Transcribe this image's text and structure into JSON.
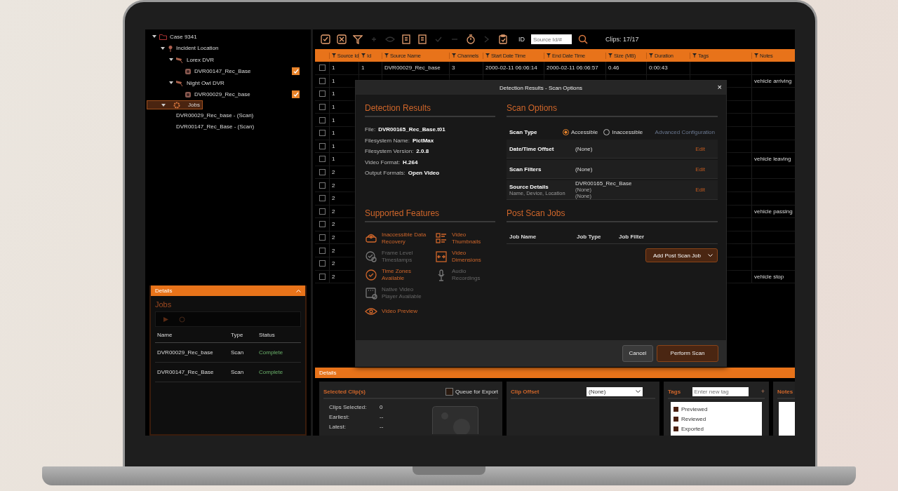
{
  "tree": [
    {
      "label": "Case 9341",
      "kind": "case",
      "expanded": true,
      "selected": false,
      "children": [
        {
          "label": "Incident Location",
          "kind": "location",
          "expanded": true,
          "selected": false,
          "children": [
            {
              "label": "Lorex DVR",
              "kind": "dvr",
              "expanded": true,
              "selected": false,
              "children": [
                {
                  "label": "DVR00147_Rec_Base",
                  "kind": "file",
                  "checked": true,
                  "selected": false
                }
              ]
            },
            {
              "label": "Night Owl DVR",
              "kind": "dvr",
              "expanded": true,
              "selected": false,
              "children": [
                {
                  "label": "DVR00029_Rec_base",
                  "kind": "file",
                  "checked": true,
                  "selected": false
                }
              ]
            }
          ]
        },
        {
          "label": "Jobs",
          "kind": "jobs",
          "expanded": true,
          "selected": true,
          "children": [
            {
              "label": "DVR00029_Rec_base - (Scan)",
              "kind": "job",
              "selected": false
            },
            {
              "label": "DVR00147_Rec_Base - (Scan)",
              "kind": "job",
              "selected": false
            }
          ]
        }
      ]
    }
  ],
  "jobs_panel": {
    "header": "Details",
    "title": "Jobs",
    "columns": [
      "Name",
      "Type",
      "Status"
    ],
    "rows": [
      {
        "name": "DVR00029_Rec_base",
        "type": "Scan",
        "status": "Complete"
      },
      {
        "name": "DVR00147_Rec_Base",
        "type": "Scan",
        "status": "Complete"
      }
    ]
  },
  "toolbar": {
    "tools": [
      {
        "kind": "check",
        "disabled": false
      },
      {
        "kind": "cross",
        "disabled": false
      },
      {
        "kind": "filter",
        "disabled": false
      },
      {
        "kind": "plus",
        "disabled": true
      },
      {
        "kind": "eye",
        "disabled": true
      },
      {
        "kind": "doc",
        "disabled": false
      },
      {
        "kind": "doc",
        "disabled": false
      },
      {
        "kind": "tick",
        "disabled": true
      },
      {
        "kind": "minus",
        "disabled": true
      },
      {
        "kind": "timer",
        "disabled": false
      },
      {
        "kind": "arrow",
        "disabled": true
      },
      {
        "kind": "clipboard",
        "disabled": false
      }
    ],
    "id_label": "ID",
    "search_placeholder": "Source Id/#",
    "clips": "Clips:  17/17"
  },
  "table": {
    "columns": [
      "Source Id",
      "Id",
      "Source Name",
      "Channels",
      "Start Date Time",
      "End Date Time",
      "Size (MB)",
      "Duration",
      "Tags",
      "Notes"
    ],
    "rows": [
      {
        "checked": false,
        "cells": [
          "1",
          "1",
          "DVR00029_Rec_base",
          "3",
          "2000-02-11 06:06:14",
          "2000-02-11 06:06:57",
          "0.46",
          "0:00:43",
          "",
          ""
        ]
      },
      {
        "checked": false,
        "cells": [
          "1",
          "",
          "",
          "",
          "",
          "",
          "",
          "",
          "",
          "vehicle arriving"
        ]
      },
      {
        "checked": false,
        "cells": [
          "1",
          "",
          "",
          "",
          "",
          "",
          "",
          "",
          "",
          ""
        ]
      },
      {
        "checked": false,
        "cells": [
          "1",
          "",
          "",
          "",
          "",
          "",
          "",
          "",
          "",
          ""
        ]
      },
      {
        "checked": false,
        "cells": [
          "1",
          "",
          "",
          "",
          "",
          "",
          "",
          "",
          "",
          ""
        ]
      },
      {
        "checked": false,
        "cells": [
          "1",
          "",
          "",
          "",
          "",
          "",
          "",
          "",
          "",
          ""
        ]
      },
      {
        "checked": false,
        "cells": [
          "1",
          "",
          "",
          "",
          "",
          "",
          "",
          "",
          "",
          ""
        ]
      },
      {
        "checked": false,
        "cells": [
          "1",
          "",
          "",
          "",
          "",
          "",
          "",
          "",
          "",
          "vehicle leaving"
        ]
      },
      {
        "checked": false,
        "cells": [
          "2",
          "",
          "",
          "",
          "",
          "",
          "",
          "",
          "",
          ""
        ]
      },
      {
        "checked": false,
        "cells": [
          "2",
          "",
          "",
          "",
          "",
          "",
          "",
          "",
          "",
          ""
        ]
      },
      {
        "checked": false,
        "cells": [
          "2",
          "",
          "",
          "",
          "",
          "",
          "",
          "",
          "",
          ""
        ]
      },
      {
        "checked": false,
        "cells": [
          "2",
          "",
          "",
          "",
          "",
          "",
          "",
          "",
          "",
          "vehicle passing"
        ]
      },
      {
        "checked": false,
        "cells": [
          "2",
          "",
          "",
          "",
          "",
          "",
          "",
          "",
          "",
          ""
        ]
      },
      {
        "checked": false,
        "cells": [
          "2",
          "",
          "",
          "",
          "",
          "",
          "",
          "",
          "",
          ""
        ]
      },
      {
        "checked": false,
        "cells": [
          "2",
          "",
          "",
          "",
          "",
          "",
          "",
          "",
          "",
          ""
        ]
      },
      {
        "checked": false,
        "cells": [
          "2",
          "",
          "",
          "",
          "",
          "",
          "",
          "",
          "",
          ""
        ]
      },
      {
        "checked": false,
        "cells": [
          "2",
          "",
          "",
          "",
          "",
          "",
          "",
          "",
          "",
          "vehicle stop"
        ]
      }
    ]
  },
  "dialog": {
    "title": "Detection Results - Scan Options",
    "close": "×",
    "detection": {
      "heading": "Detection Results",
      "fields": [
        {
          "label": "File:",
          "value": "DVR00165_Rec_Base.t01"
        },
        {
          "label": "Filesystem Name:",
          "value": "PictMax"
        },
        {
          "label": "Filesystem Version:",
          "value": "2.0.8"
        },
        {
          "label": "Video Format:",
          "value": "H.264"
        },
        {
          "label": "Output Formats:",
          "value": "Open Video"
        }
      ]
    },
    "features": {
      "heading": "Supported Features",
      "items": [
        {
          "kind": "drive",
          "label": "Inaccessible Data Recovery",
          "supported": true
        },
        {
          "kind": "timestamp",
          "label": "Frame Level Timestamps",
          "supported": false
        },
        {
          "kind": "timezone",
          "label": "Time Zones Available",
          "supported": true
        },
        {
          "kind": "player",
          "label": "Native Video Player Available",
          "supported": false
        },
        {
          "kind": "preview",
          "label": "Video Preview",
          "supported": true
        },
        {
          "kind": "thumbnails",
          "label": "Video Thumbnails",
          "supported": true
        },
        {
          "kind": "dimensions",
          "label": "Video Dimensions",
          "supported": true
        },
        {
          "kind": "audio",
          "label": "Audio Recordings",
          "supported": false
        }
      ]
    },
    "scan": {
      "heading": "Scan Options",
      "type_label": "Scan Type",
      "types": [
        {
          "label": "Accessible",
          "selected": true
        },
        {
          "label": "Inaccessible",
          "selected": false
        }
      ],
      "advanced": "Advanced Configuration",
      "rows": [
        {
          "label": "Date/Time Offset",
          "values": [
            "(None)"
          ],
          "action": "Edit"
        },
        {
          "label": "Scan Filters",
          "values": [
            "(None)"
          ],
          "action": "Edit"
        },
        {
          "label": "Source Details",
          "sublabel": "Name, Device, Location",
          "values": [
            "DVR00165_Rec_Base",
            "(None)",
            "(None)"
          ],
          "action": "Edit"
        }
      ]
    },
    "post_jobs": {
      "heading": "Post Scan Jobs",
      "columns": [
        "Job Name",
        "Job Type",
        "Job Filter"
      ],
      "add_button": "Add Post Scan Job"
    },
    "buttons": [
      {
        "label": "Cancel",
        "kind": "secondary"
      },
      {
        "label": "Perform Scan",
        "kind": "primary"
      }
    ]
  },
  "details": {
    "header": "Details",
    "selected_clips": {
      "title": "Selected Clip(s)",
      "queue_label": "Queue for Export",
      "queue_checked": false,
      "fields": [
        {
          "label": "Clips Selected:",
          "value": "0"
        },
        {
          "label": "Earliest:",
          "value": "--"
        },
        {
          "label": "Latest:",
          "value": "--"
        }
      ]
    },
    "clip_offset": {
      "title": "Clip Offset",
      "value": "(None)"
    },
    "tags": {
      "title": "Tags",
      "placeholder": "Enter new tag",
      "add": "+",
      "items": [
        {
          "label": "Previewed",
          "checked": false
        },
        {
          "label": "Reviewed",
          "checked": false
        },
        {
          "label": "Exported",
          "checked": false
        }
      ]
    },
    "notes": {
      "title": "Notes"
    }
  }
}
